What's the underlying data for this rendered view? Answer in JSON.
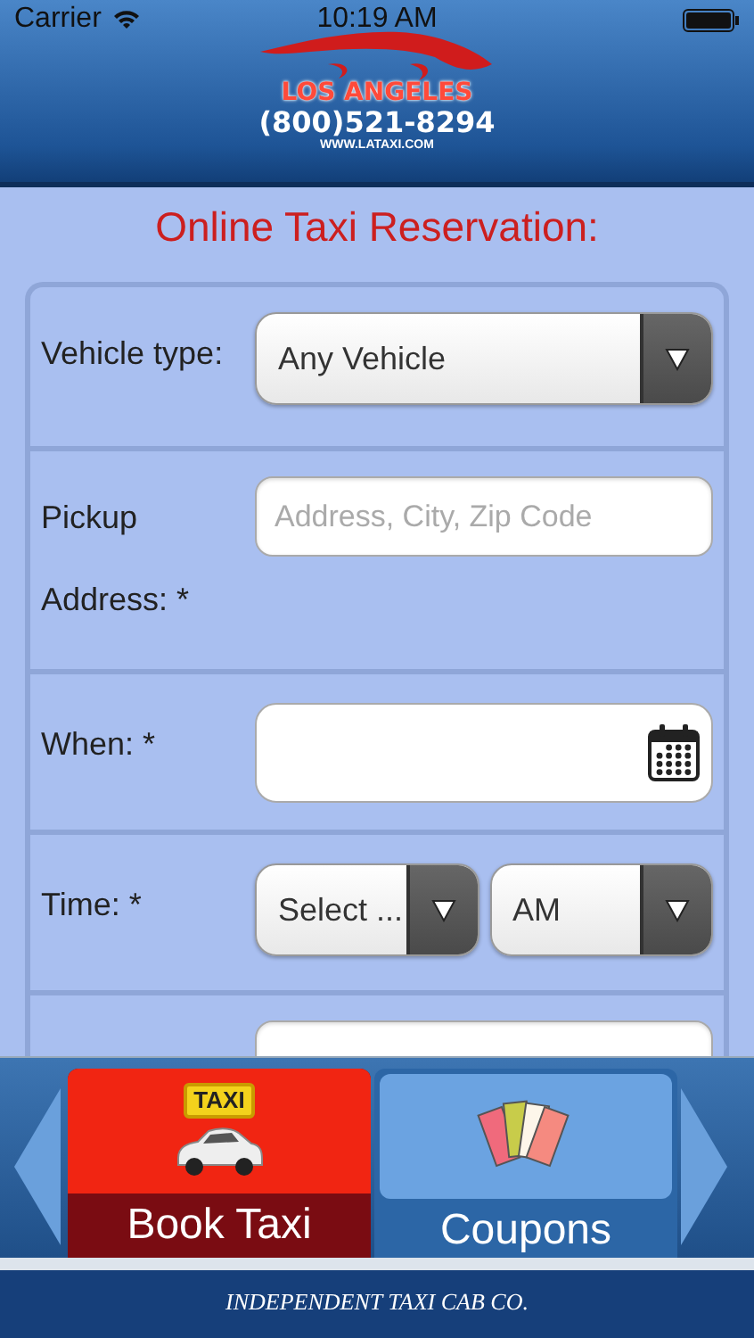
{
  "status_bar": {
    "carrier": "Carrier",
    "time": "10:19 AM"
  },
  "header": {
    "city": "LOS ANGELES",
    "phone": "(800)521-8294",
    "website": "WWW.LATAXI.COM"
  },
  "title": "Online Taxi Reservation:",
  "form": {
    "rows": [
      {
        "kind": "select",
        "label": "Vehicle type:",
        "value": "Any Vehicle"
      },
      {
        "kind": "text",
        "label": "Pickup Address: *",
        "placeholder": "Address, City, Zip Code"
      },
      {
        "kind": "date",
        "label": "When: *"
      },
      {
        "kind": "time",
        "label": "Time: *",
        "selects": [
          {
            "value": "Select ..."
          },
          {
            "value": "AM"
          }
        ]
      },
      {
        "kind": "text"
      }
    ]
  },
  "tabs": [
    {
      "kind": "taxi",
      "label": "Book Taxi",
      "sign": "TAXI",
      "selected": true
    },
    {
      "kind": "coupons",
      "label": "Coupons",
      "selected": false
    }
  ],
  "footer": "INDEPENDENT TAXI CAB CO."
}
